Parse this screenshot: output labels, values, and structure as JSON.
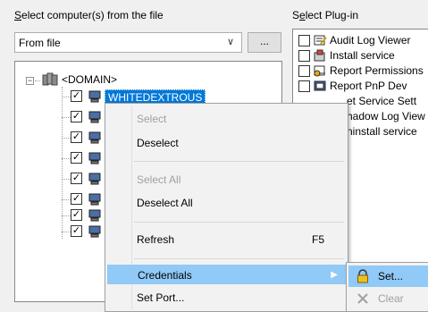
{
  "left_panel": {
    "label_underlined": "S",
    "label_rest": "elect computer(s) from the file",
    "combo_value": "From file",
    "browse_label": "...",
    "tree": {
      "root_label": "<DOMAIN>",
      "selected_node_label": "WHITEDEXTROUS"
    }
  },
  "right_panel": {
    "label_pre": "S",
    "label_underlined": "e",
    "label_rest": "lect Plug-in",
    "plugins": [
      "Audit Log Viewer",
      "Install service",
      "Report Permissions",
      "Report PnP Dev",
      "et Service Sett",
      "hadow Log View",
      "ninstall service"
    ]
  },
  "context_menu": {
    "select": "Select",
    "deselect": "Deselect",
    "select_all": "Select All",
    "deselect_all": "Deselect All",
    "refresh": "Refresh",
    "refresh_shortcut": "F5",
    "credentials": "Credentials",
    "set_port": "Set Port..."
  },
  "submenu": {
    "set": "Set...",
    "clear": "Clear"
  },
  "colors": {
    "selection": "#0078d7",
    "menu_highlight": "#91c9f7"
  }
}
